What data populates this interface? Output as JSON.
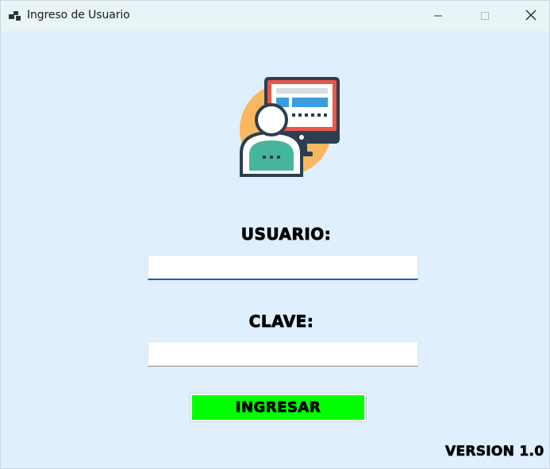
{
  "window": {
    "title": "Ingreso de Usuario",
    "app_icon": "windows-form-icon",
    "controls": {
      "minimize_icon": "minimize-icon",
      "maximize_icon": "maximize-icon",
      "close_icon": "close-icon"
    }
  },
  "hero": {
    "icon": "user-at-computer-icon"
  },
  "form": {
    "username_label": "USUARIO:",
    "username_value": "",
    "password_label": "CLAVE:",
    "password_value": "",
    "submit_label": "INGRESAR"
  },
  "footer": {
    "version": "VERSION 1.0"
  },
  "colors": {
    "background": "#dfeffd",
    "titlebar": "#e9f4f6",
    "submit_button": "#00ff00",
    "focus_underline": "#1a63b8"
  }
}
